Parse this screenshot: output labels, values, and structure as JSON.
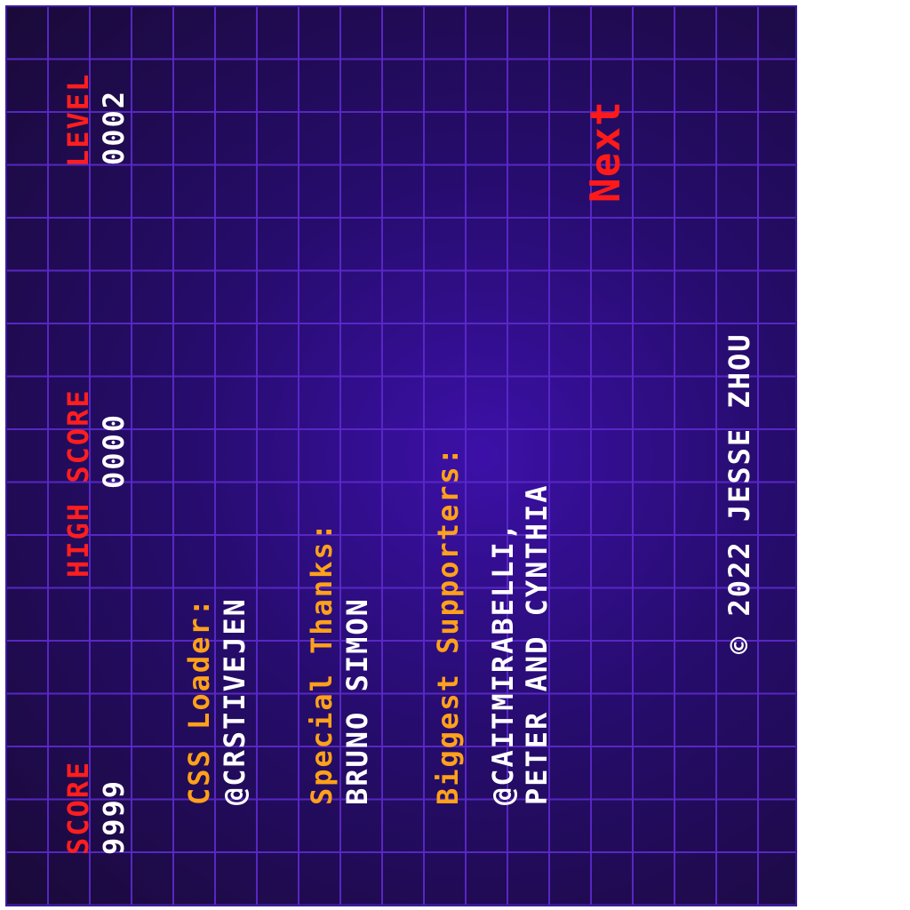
{
  "hud": {
    "score_label": "SCORE",
    "score_value": "9999",
    "high_score_label": "HIGH SCORE",
    "high_score_value": "0000",
    "level_label": "LEVEL",
    "level_value": "0002"
  },
  "credits": {
    "css_loader_heading": "CSS Loader:",
    "css_loader_name": "@CRSTIVEJEN",
    "special_thanks_heading": "Special Thanks:",
    "special_thanks_name": "BRUNO SIMON",
    "supporters_heading": "Biggest Supporters:",
    "supporters_line1": "@CAITMIRABELLI,",
    "supporters_line2": "PETER AND CYNTHIA"
  },
  "next_button_label": "Next",
  "copyright": "© 2022 JESSE ZHOU",
  "colors": {
    "background": "#1d0a3d",
    "grid": "#5a28c8",
    "label_red": "#ff1e1e",
    "heading_orange": "#ffa11a",
    "text_white": "#ffffff"
  }
}
